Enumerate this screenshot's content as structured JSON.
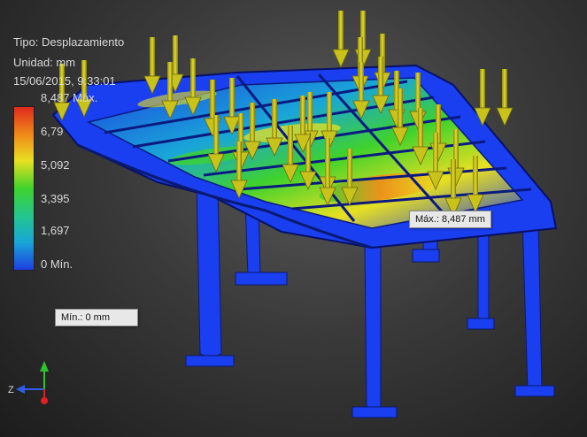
{
  "result_info": {
    "type_line": "Tipo: Desplazamiento",
    "unit_line": "Unidad: mm",
    "date_line": "15/06/2015, 9:33:01"
  },
  "legend": {
    "gradient_colors": [
      "#e0281c",
      "#f08a1a",
      "#e8e021",
      "#3fd22c",
      "#23c58f",
      "#19a6d8",
      "#1d3fe0"
    ],
    "ticks": [
      "8,487 Máx.",
      "6,79",
      "5,092",
      "3,395",
      "1,697",
      "0 Mín."
    ],
    "min_value": 0,
    "max_value": 8.487
  },
  "callouts": {
    "max": "Máx.: 8,487 mm",
    "min": "Mín.: 0 mm"
  },
  "triad": {
    "z_label": "Z",
    "x_color": "#e02020",
    "y_color": "#2fc22f",
    "z_color": "#2f5fe8"
  },
  "colors": {
    "structure_blue": "#1a3ff0",
    "arrow_yellow": "#c9c21a"
  }
}
